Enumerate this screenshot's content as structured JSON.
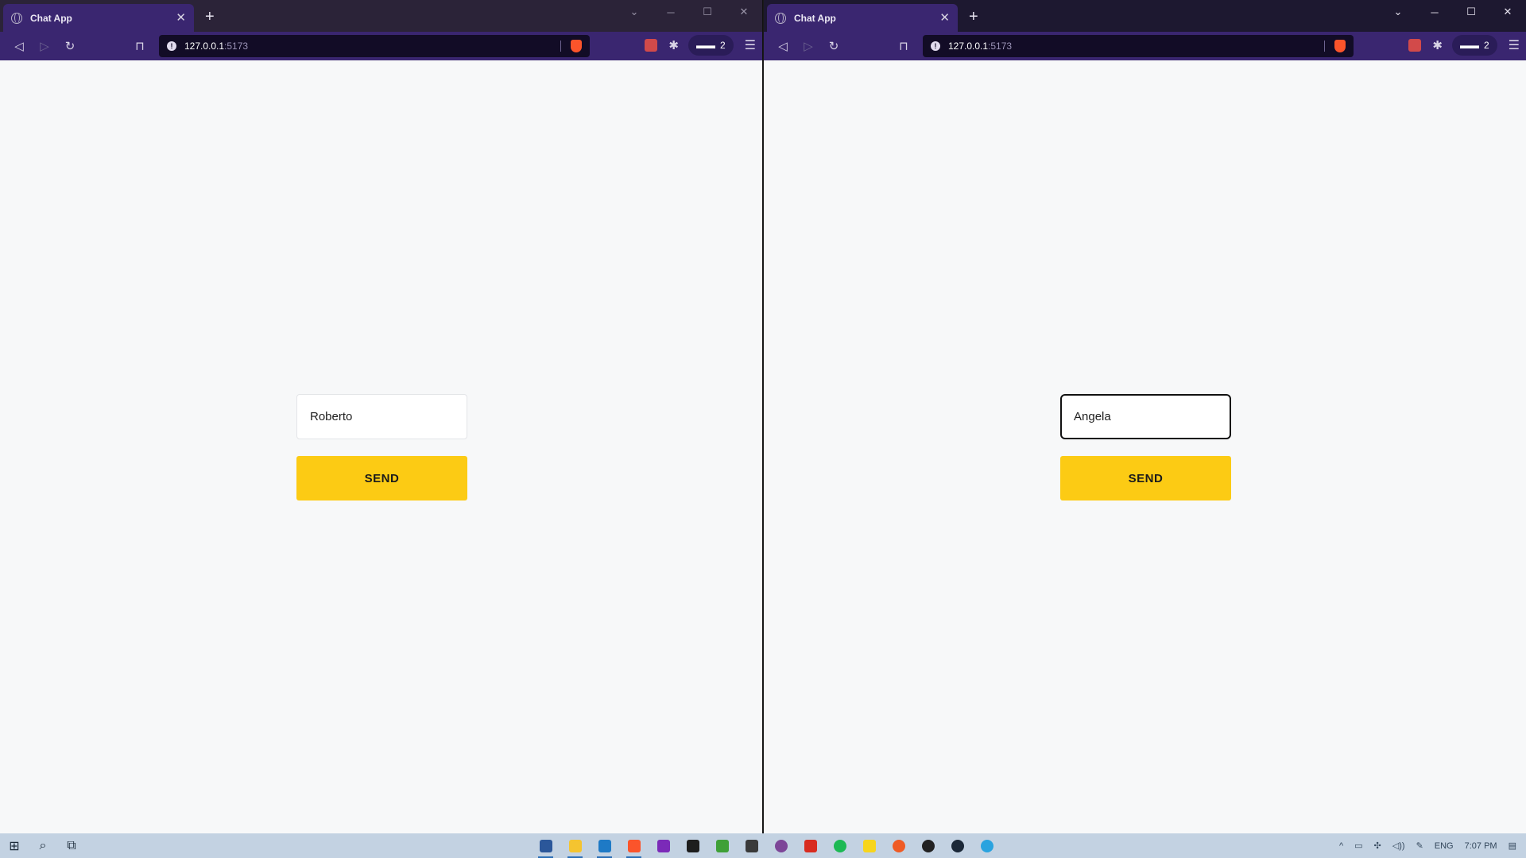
{
  "left_window": {
    "tab_title": "Chat App",
    "url_host": "127.0.0.1",
    "url_port": ":5173",
    "shields_count": "2",
    "form": {
      "name_value": "Roberto",
      "send_label": "SEND",
      "input_focused": false
    }
  },
  "right_window": {
    "tab_title": "Chat App",
    "url_host": "127.0.0.1",
    "url_port": ":5173",
    "shields_count": "2",
    "form": {
      "name_value": "Angela",
      "send_label": "SEND",
      "input_focused": true
    }
  },
  "taskbar": {
    "language": "ENG",
    "time": "7:07 PM",
    "apps": [
      {
        "icon": "word-icon",
        "color": "#2b579a",
        "active": true
      },
      {
        "icon": "file-explorer-icon",
        "color": "#f4c430",
        "active": true
      },
      {
        "icon": "vscode-icon",
        "color": "#1e7ac6",
        "active": true
      },
      {
        "icon": "brave-icon",
        "color": "#fb542b",
        "active": true
      },
      {
        "icon": "insomnia-icon",
        "color": "#7b2ab8",
        "active": false
      },
      {
        "icon": "figma-icon",
        "color": "#1e1e1e",
        "active": false
      },
      {
        "icon": "mongodb-compass-icon",
        "color": "#3fa037",
        "active": false
      },
      {
        "icon": "sublime-text-icon",
        "color": "#3a3a3a",
        "active": false
      },
      {
        "icon": "tor-browser-icon",
        "color": "#7d4698",
        "active": false
      },
      {
        "icon": "redis-icon",
        "color": "#d82c20",
        "active": false
      },
      {
        "icon": "spotify-icon",
        "color": "#1db954",
        "active": false
      },
      {
        "icon": "sticky-notes-icon",
        "color": "#f7d51d",
        "active": false
      },
      {
        "icon": "postman-icon",
        "color": "#ef5b25",
        "active": false
      },
      {
        "icon": "wikipedia-icon",
        "color": "#222222",
        "active": false
      },
      {
        "icon": "steam-icon",
        "color": "#1b2838",
        "active": false
      },
      {
        "icon": "telegram-icon",
        "color": "#2aa3df",
        "active": false
      }
    ]
  }
}
